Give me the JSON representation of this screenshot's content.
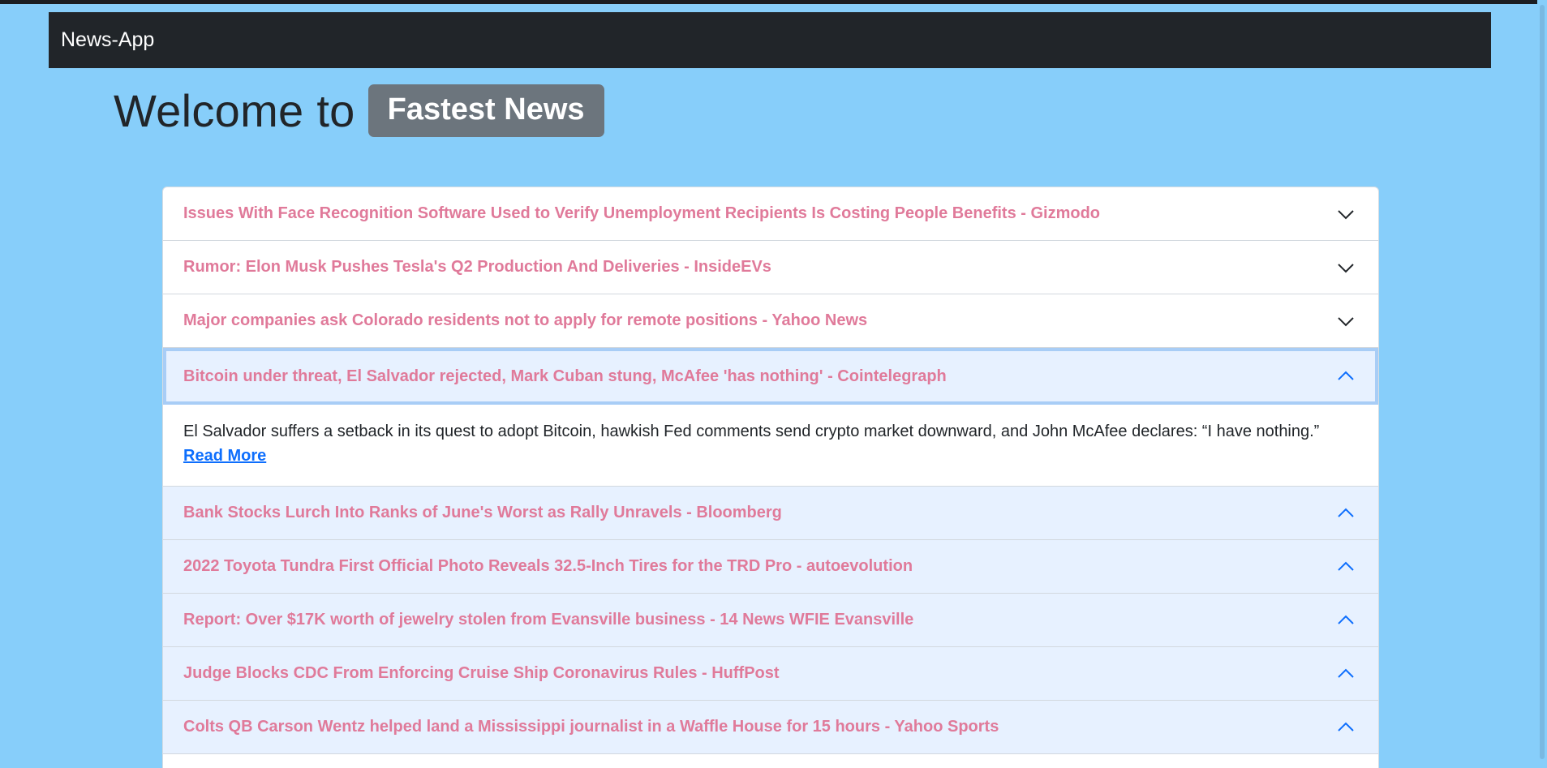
{
  "navbar": {
    "brand": "News-App"
  },
  "hero": {
    "welcome": "Welcome to",
    "badge": "Fastest News"
  },
  "accordion": {
    "items": [
      {
        "title": "Issues With Face Recognition Software Used to Verify Unemployment Recipients Is Costing People Benefits - Gizmodo",
        "state": "collapsed"
      },
      {
        "title": "Rumor: Elon Musk Pushes Tesla's Q2 Production And Deliveries - InsideEVs",
        "state": "collapsed"
      },
      {
        "title": "Major companies ask Colorado residents not to apply for remote positions - Yahoo News",
        "state": "collapsed"
      },
      {
        "title": "Bitcoin under threat, El Salvador rejected, Mark Cuban stung, McAfee 'has nothing' - Cointelegraph",
        "state": "expanded",
        "description": "El Salvador suffers a setback in its quest to adopt Bitcoin, hawkish Fed comments send crypto market downward, and John McAfee declares: “I have nothing.”",
        "read_more": "Read More"
      },
      {
        "title": "Bank Stocks Lurch Into Ranks of June's Worst as Rally Unravels - Bloomberg",
        "state": "expanded"
      },
      {
        "title": "2022 Toyota Tundra First Official Photo Reveals 32.5-Inch Tires for the TRD Pro - autoevolution",
        "state": "expanded"
      },
      {
        "title": "Report: Over $17K worth of jewelry stolen from Evansville business - 14 News WFIE Evansville",
        "state": "expanded"
      },
      {
        "title": "Judge Blocks CDC From Enforcing Cruise Ship Coronavirus Rules - HuffPost",
        "state": "expanded"
      },
      {
        "title": "Colts QB Carson Wentz helped land a Mississippi journalist in a Waffle House for 15 hours - Yahoo Sports",
        "state": "expanded"
      }
    ]
  },
  "icons": {
    "collapsed": "chevron-down-icon",
    "expanded": "chevron-up-icon"
  },
  "colors": {
    "page_bg": "#87cefa",
    "navbar_bg": "#212529",
    "badge_bg": "#6c757d",
    "title_color": "#e07a9a",
    "expanded_bg": "#e7f1ff",
    "link_color": "#0d6efd"
  }
}
